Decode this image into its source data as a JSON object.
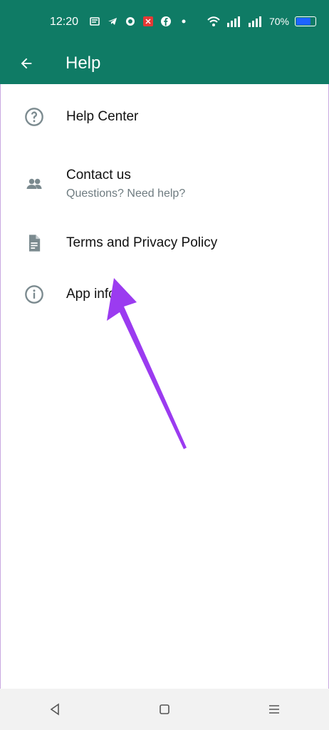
{
  "status_bar": {
    "time": "12:20",
    "battery": "70%",
    "battery_fill": 0.7,
    "icons": [
      "notification-icon",
      "telegram-icon",
      "whatsapp-icon",
      "app-icon",
      "facebook-icon",
      "dot-icon"
    ]
  },
  "app_bar": {
    "title": "Help"
  },
  "menu": [
    {
      "label": "Help Center",
      "icon": "help-circle-icon"
    },
    {
      "label": "Contact us",
      "subtitle": "Questions? Need help?",
      "icon": "people-icon"
    },
    {
      "label": "Terms and Privacy Policy",
      "icon": "document-icon"
    },
    {
      "label": "App info",
      "icon": "info-icon"
    }
  ],
  "colors": {
    "app_bar": "#0f7b65",
    "icon_gray": "#7b8a8f",
    "annotation_arrow": "#9b3bf0"
  }
}
